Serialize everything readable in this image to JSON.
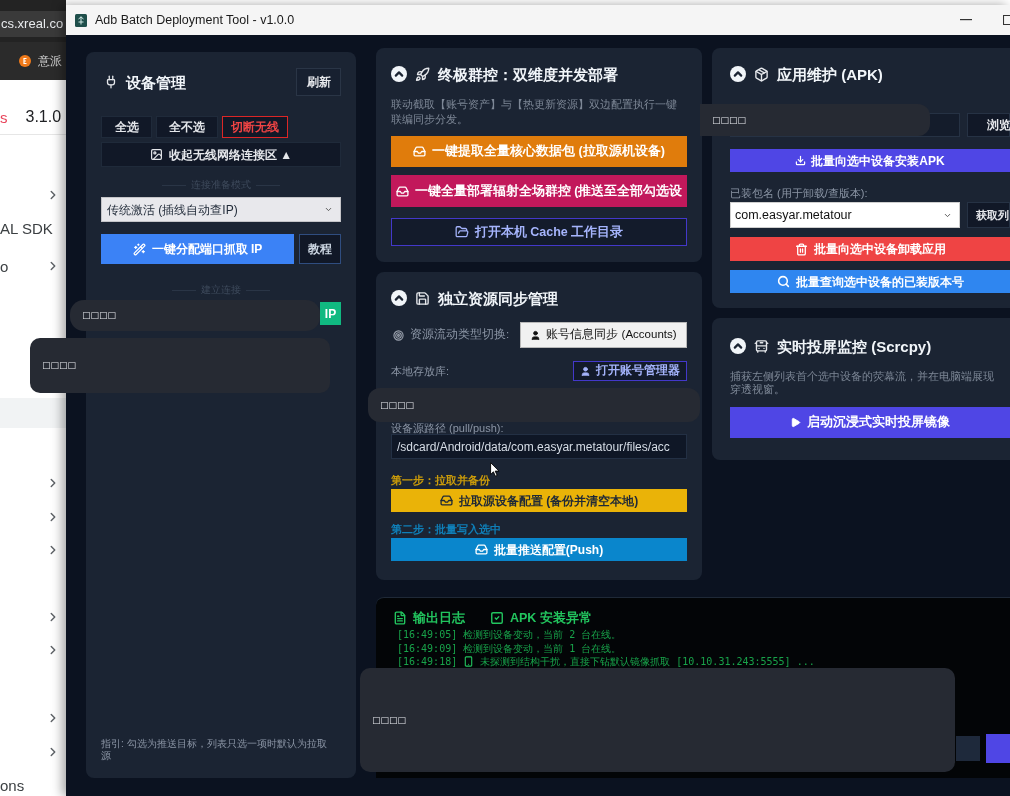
{
  "browser_window": {
    "address": "cs.xreal.co",
    "bookmark": "意派",
    "version_tag": "s",
    "version": "3.1.0",
    "nav_rows": [
      {
        "kind": "chevron"
      },
      {
        "kind": "label",
        "label": "AL SDK"
      },
      {
        "kind": "label_chevron",
        "label": "o"
      },
      {
        "kind": "highlight"
      },
      {
        "kind": "chevron"
      },
      {
        "kind": "chevron"
      },
      {
        "kind": "chevron"
      },
      {
        "kind": "chevron"
      },
      {
        "kind": "chevron"
      },
      {
        "kind": "chevron"
      },
      {
        "kind": "chevron"
      },
      {
        "kind": "label",
        "label": "ons"
      }
    ]
  },
  "window": {
    "title": "Adb Batch Deployment Tool - v1.0.0"
  },
  "device_panel": {
    "title": "设备管理",
    "refresh_button": "刷新",
    "select_buttons": [
      {
        "label": "全选",
        "kind": "plain"
      },
      {
        "label": "全不选",
        "kind": "plain"
      },
      {
        "label": "切断无线",
        "kind": "danger"
      }
    ],
    "collapse_bar": "收起无线网络连接区 ▲",
    "mode_divider": "连接准备模式",
    "mode_select": {
      "value": "传统激活 (插线自动查IP)"
    },
    "assign_button": "一键分配端口抓取 IP",
    "tutorial_button": "教程",
    "connect_divider": "建立连接",
    "connect_button": "IP",
    "hint": "指引: 勾选为推送目标，列表只选一项时默认为拉取源"
  },
  "deploy_panel": {
    "title": "终极群控：双维度并发部署",
    "expanded": true,
    "description": "联动截取【账号资产】与【热更新资源】双边配置执行一键联编同步分发。",
    "buttons": [
      {
        "label": "一键提取全量核心数据包 (拉取源机设备)",
        "kind": "orange"
      },
      {
        "label": "一键全量部署辐射全场群控 (推送至全部勾选设",
        "kind": "pink"
      },
      {
        "label": "打开本机 Cache 工作目录",
        "kind": "outline"
      }
    ]
  },
  "sync_panel": {
    "title": "独立资源同步管理",
    "expanded": true,
    "type_label": "资源流动类型切换:",
    "type_select": {
      "value": "账号信息同步 (Accounts)"
    },
    "storage_label": "本地存放库:",
    "open_manager_button": "打开账号管理器",
    "path_label": "设备源路径 (pull/push):",
    "path_field": {
      "value": "/sdcard/Android/data/com.easyar.metatour/files/acc"
    },
    "steps": [
      {
        "label": "第一步：拉取并备份",
        "button": "拉取源设备配置 (备份并清空本地)",
        "kind": "pull"
      },
      {
        "label": "第二步：批量写入选中",
        "button": "批量推送配置(Push)",
        "kind": "push"
      }
    ]
  },
  "apk_panel": {
    "title": "应用维护 (APK)",
    "expanded": true,
    "browse_button": "浏览",
    "install_button": "批量向选中设备安装APK",
    "package_label": "已装包名 (用于卸载/查版本):",
    "package_select": {
      "value": "com.easyar.metatour"
    },
    "fetch_button": "获取列",
    "actions": [
      {
        "label": "批量向选中设备卸载应用",
        "kind": "uninstall"
      },
      {
        "label": "批量查询选中设备的已装版本号",
        "kind": "query"
      }
    ]
  },
  "mirror_panel": {
    "title": "实时投屏监控 (Scrcpy)",
    "expanded": true,
    "description_lines": [
      "捕获左侧列表首个选中设备的荧幕流，并在电脑端展现",
      "穿透视窗。"
    ],
    "start_button": "启动沉浸式实时投屏镜像"
  },
  "log_panel": {
    "title": "输出日志",
    "error_filter": {
      "label": "APK 安装异常",
      "checked": true
    },
    "lines": [
      {
        "time": "[16:49:05]",
        "message": "检测到设备变动，当前 2 台在线。",
        "kind": "plain"
      },
      {
        "time": "[16:49:09]",
        "message": "检测到设备变动，当前 1 台在线。",
        "kind": "plain"
      },
      {
        "time": "[16:49:18]",
        "message": "未探测到结构干扰，直接下钻默认镜像抓取 [10.10.31.243:5555] ...",
        "kind": "device"
      }
    ]
  },
  "overlays": [
    {
      "text": "□□□□"
    },
    {
      "text": "□□□□"
    },
    {
      "text": "□□□□"
    },
    {
      "text": "□□□□"
    },
    {
      "text": "□□□□"
    }
  ]
}
